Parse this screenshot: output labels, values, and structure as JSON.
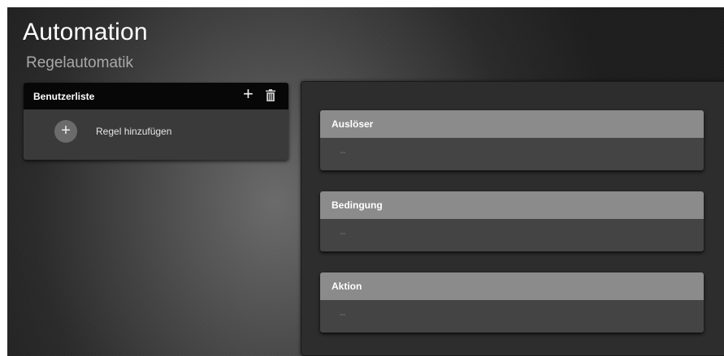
{
  "header": {
    "title": "Automation",
    "subtitle": "Regelautomatik"
  },
  "rule_list": {
    "title": "Benutzerliste",
    "add_icon": "plus-icon",
    "delete_icon": "trash-icon",
    "add_rule_label": "Regel hinzufügen"
  },
  "editor": {
    "sections": [
      {
        "title": "Auslöser",
        "value": "--"
      },
      {
        "title": "Bedingung",
        "value": "--"
      },
      {
        "title": "Aktion",
        "value": "--"
      }
    ]
  },
  "colors": {
    "header_bar": "#070707",
    "section_header": "#8b8b8b",
    "section_body": "#444444",
    "subtitle": "#a8a8a8"
  }
}
